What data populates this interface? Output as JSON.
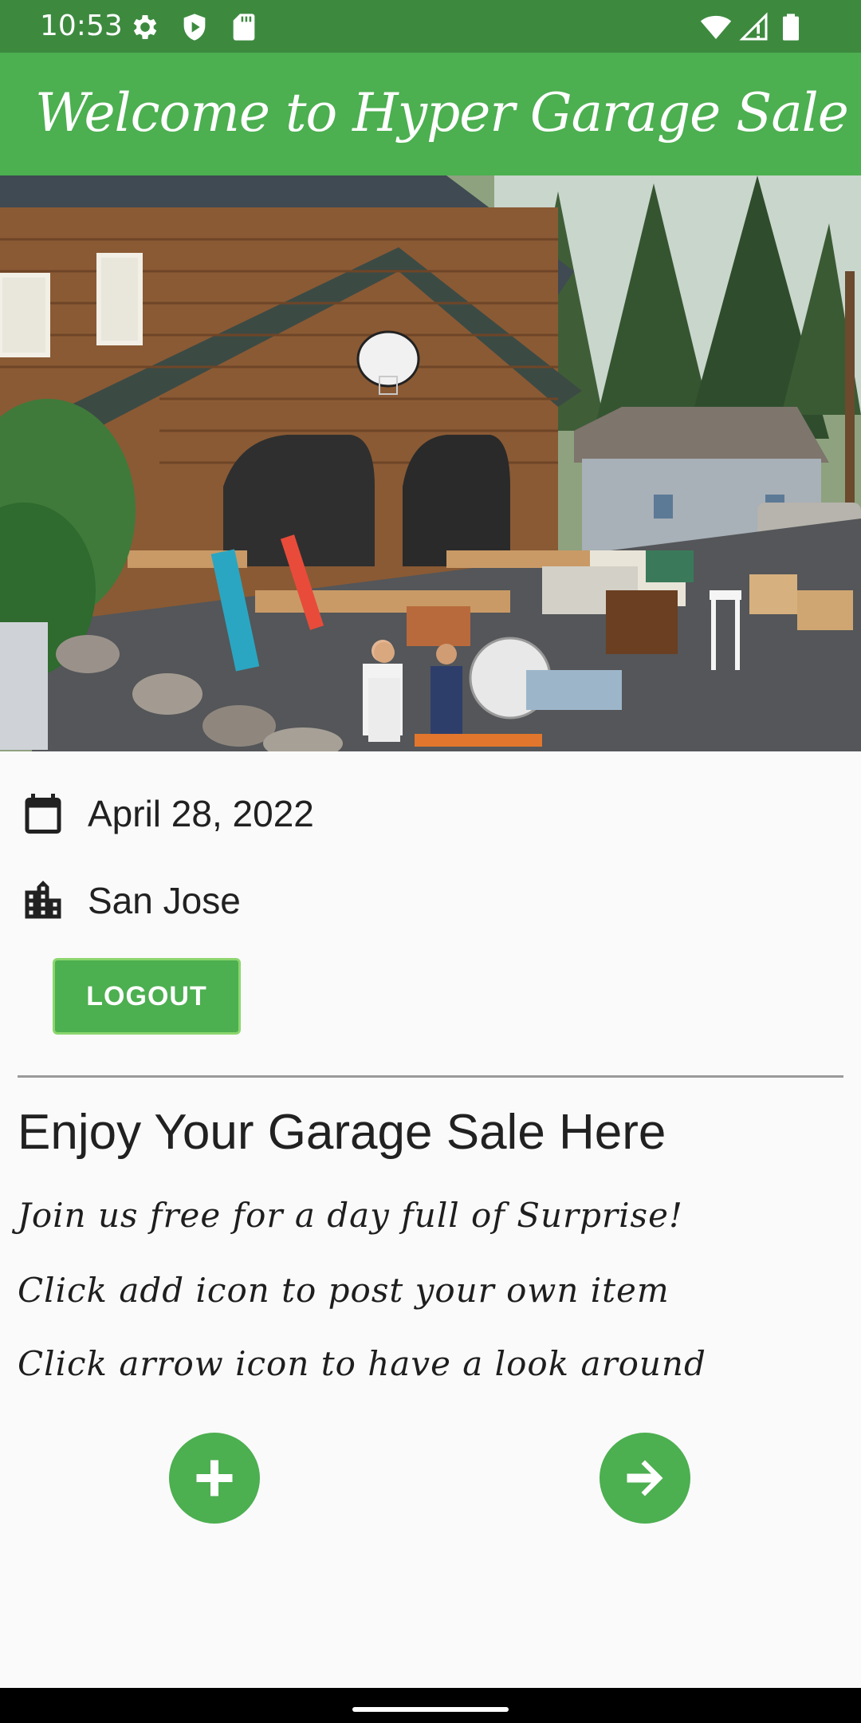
{
  "status_bar": {
    "time": "10:53",
    "left_icons": [
      "gear-icon",
      "shield-icon",
      "sd-card-icon"
    ],
    "right_icons": [
      "wifi-icon",
      "signal-icon",
      "battery-icon"
    ],
    "background": "#3d8a3f"
  },
  "app_bar": {
    "title": "Welcome to Hyper Garage Sale",
    "background": "#4caf50"
  },
  "hero": {
    "description_icon": "garage-sale-photo"
  },
  "event": {
    "date": "April 28, 2022",
    "date_icon": "calendar-icon",
    "city": "San Jose",
    "city_icon": "city-icon"
  },
  "actions": {
    "logout_label": "LOGOUT"
  },
  "content": {
    "heading": "Enjoy Your Garage Sale Here",
    "lines": [
      "Join us free for a day full of Surprise!",
      "Click add icon to post your own item",
      "Click arrow icon to have a look around"
    ]
  },
  "fabs": {
    "add_icon": "plus-icon",
    "browse_icon": "arrow-right-icon",
    "color": "#4caf50"
  }
}
